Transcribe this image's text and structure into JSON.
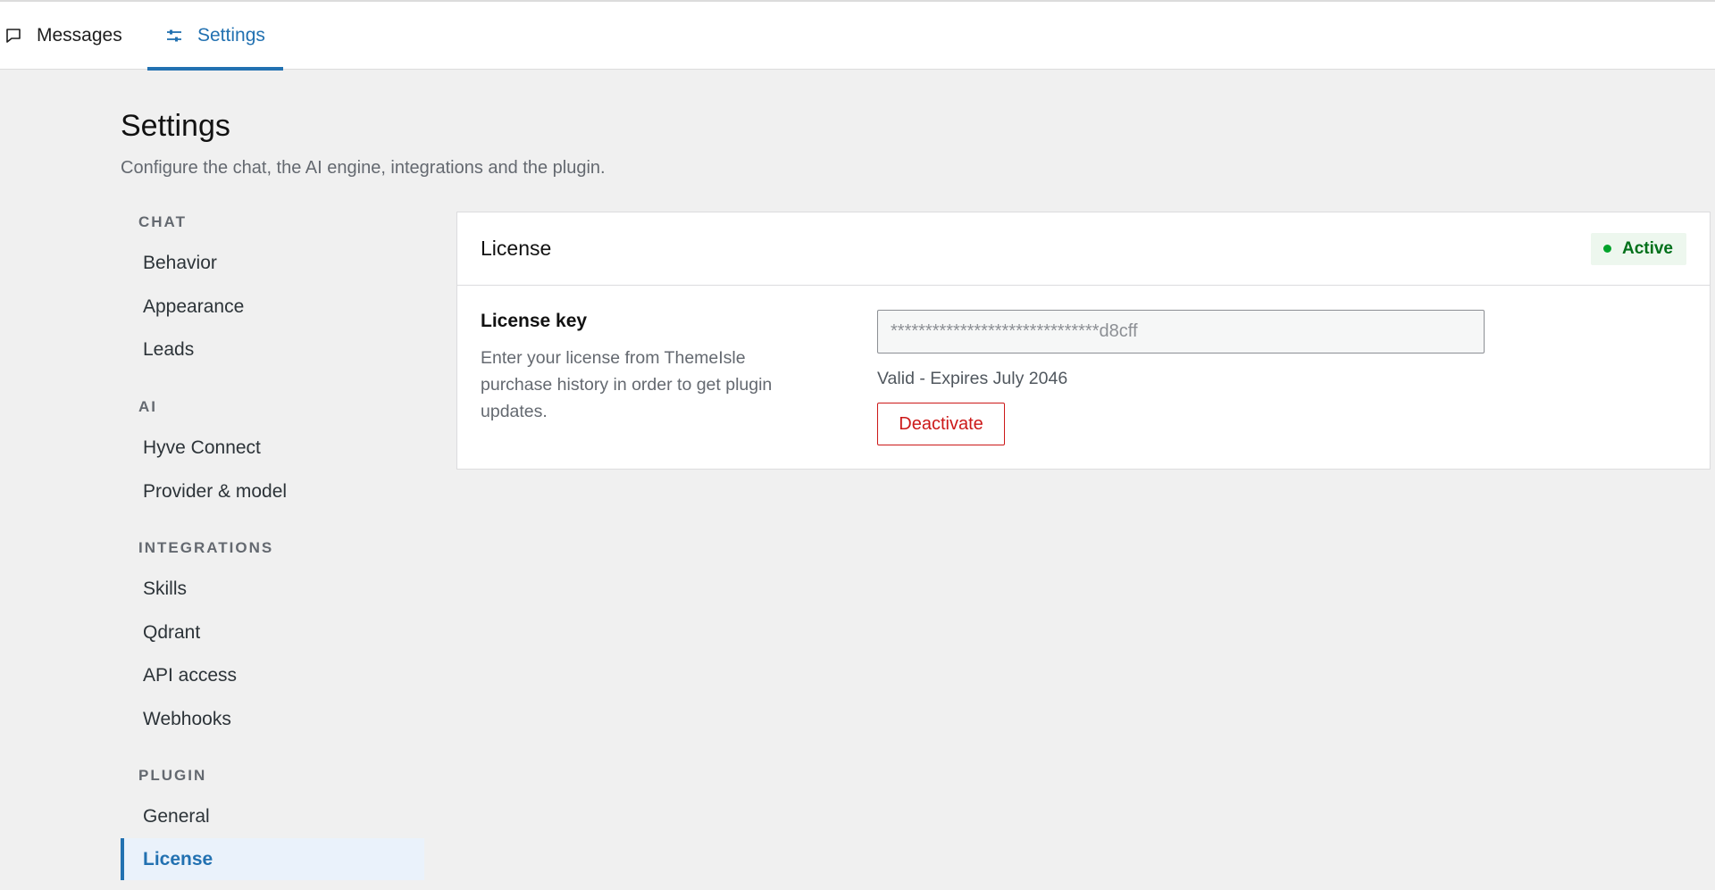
{
  "tabs": {
    "messages": {
      "label": "Messages",
      "icon": "comment-icon"
    },
    "settings": {
      "label": "Settings",
      "icon": "sliders-icon"
    }
  },
  "page": {
    "title": "Settings",
    "subtitle": "Configure the chat, the AI engine, integrations and the plugin."
  },
  "nav": {
    "groups": {
      "chat": {
        "label": "CHAT",
        "items": [
          "Behavior",
          "Appearance",
          "Leads"
        ]
      },
      "ai": {
        "label": "AI",
        "items": [
          "Hyve Connect",
          "Provider & model"
        ]
      },
      "integrations": {
        "label": "INTEGRATIONS",
        "items": [
          "Skills",
          "Qdrant",
          "API access",
          "Webhooks"
        ]
      },
      "plugin": {
        "label": "PLUGIN",
        "items": [
          "General",
          "License"
        ]
      }
    },
    "active_item": "License"
  },
  "license_card": {
    "title": "License",
    "status_badge": "Active",
    "status_color": "#00a32a",
    "field_label": "License key",
    "field_description": "Enter your license from ThemeIsle purchase history in order to get plugin updates.",
    "field_value": "******************************d8cff",
    "validity_text": "Valid - Expires July 2046",
    "deactivate_label": "Deactivate"
  },
  "colors": {
    "accent": "#2271b1",
    "danger": "#cc1818",
    "success": "#00a32a"
  }
}
